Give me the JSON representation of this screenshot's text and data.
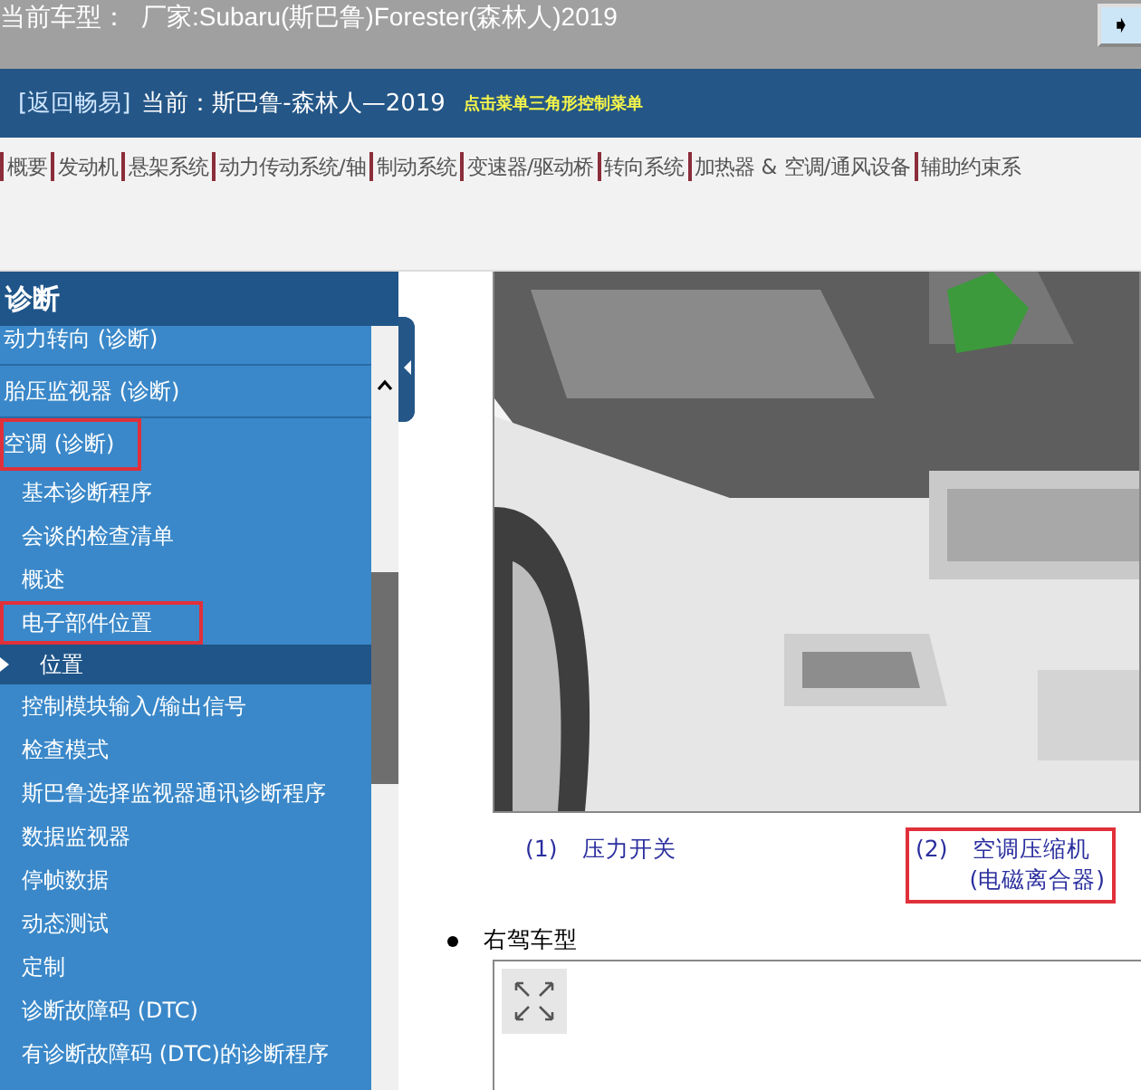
{
  "header": {
    "label": "当前车型：",
    "model": "厂家:Subaru(斯巴鲁)Forester(森林人)2019",
    "button_icon": "➧"
  },
  "breadcrumb": {
    "back_link": "[返回畅易]",
    "current": "当前：斯巴鲁-森林人—2019",
    "hint": "点击菜单三角形控制菜单"
  },
  "nav_items": [
    "概要",
    "发动机",
    "悬架系统",
    "动力传动系统/轴",
    "制动系统",
    "变速器/驱动桥",
    "转向系统",
    "加热器 & 空调/通风设备",
    "辅助约束系"
  ],
  "sidebar": {
    "title": "诊断",
    "items": [
      {
        "label": "动力转向 (诊断)",
        "selected": false,
        "highlighted": false
      },
      {
        "label": "胎压监视器 (诊断)",
        "selected": false,
        "highlighted": false
      },
      {
        "label": "空调 (诊断)",
        "selected": false,
        "highlighted": true,
        "children": [
          {
            "label": "基本诊断程序",
            "selected": false,
            "highlighted": false
          },
          {
            "label": "会谈的检查清单",
            "selected": false,
            "highlighted": false
          },
          {
            "label": "概述",
            "selected": false,
            "highlighted": false
          },
          {
            "label": "电子部件位置",
            "selected": false,
            "highlighted": true,
            "children": [
              {
                "label": "位置",
                "selected": true,
                "highlighted": false
              }
            ]
          },
          {
            "label": "控制模块输入/输出信号",
            "selected": false,
            "highlighted": false
          },
          {
            "label": "检查模式",
            "selected": false,
            "highlighted": false
          },
          {
            "label": "斯巴鲁选择监视器通讯诊断程序",
            "selected": false,
            "highlighted": false
          },
          {
            "label": "数据监视器",
            "selected": false,
            "highlighted": false
          },
          {
            "label": "停帧数据",
            "selected": false,
            "highlighted": false
          },
          {
            "label": "动态测试",
            "selected": false,
            "highlighted": false
          },
          {
            "label": "定制",
            "selected": false,
            "highlighted": false
          },
          {
            "label": "诊断故障码 (DTC)",
            "selected": false,
            "highlighted": false
          },
          {
            "label": "有诊断故障码 (DTC)的诊断程序",
            "selected": false,
            "highlighted": false
          }
        ]
      }
    ]
  },
  "content": {
    "callouts": [
      {
        "number": "(1)",
        "text": "压力开关",
        "highlighted": false
      },
      {
        "number": "(2)",
        "text": "空调压缩机",
        "subtext": "(电磁离合器)",
        "highlighted": true
      }
    ],
    "bullets": [
      {
        "text": "右驾车型"
      }
    ]
  }
}
